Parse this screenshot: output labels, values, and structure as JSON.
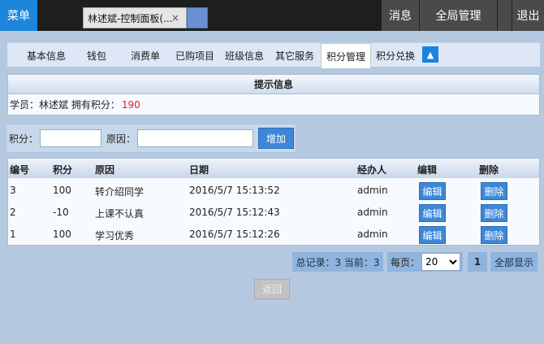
{
  "topbar": {
    "menu": "菜单",
    "doc_tab": "林述斌-控制面板(...",
    "doc_tab_close": "×",
    "messages": "消息",
    "global_admin": "全局管理",
    "logout": "退出"
  },
  "tabs": [
    {
      "label": "基本信息"
    },
    {
      "label": "钱包"
    },
    {
      "label": "消费单"
    },
    {
      "label": "已购项目"
    },
    {
      "label": "班级信息"
    },
    {
      "label": "其它服务"
    },
    {
      "label": "积分管理"
    },
    {
      "label": "积分兑换"
    }
  ],
  "active_tab": "积分管理",
  "tab_up_icon": "▲",
  "info": {
    "title": "提示信息",
    "student_label": "学员：林述斌  拥有积分：",
    "points": "190"
  },
  "form": {
    "score_label": "积分：",
    "reason_label": "原因：",
    "score_value": "",
    "reason_value": "",
    "add_button": "增加"
  },
  "table": {
    "headers": [
      "编号",
      "积分",
      "原因",
      "日期",
      "经办人",
      "编辑",
      "删除"
    ],
    "rows": [
      {
        "id": "3",
        "score": "100",
        "reason": "转介绍同学",
        "date": "2016/5/7 15:13:52",
        "operator": "admin",
        "edit": "编辑",
        "delete": "删除"
      },
      {
        "id": "2",
        "score": "-10",
        "reason": "上课不认真",
        "date": "2016/5/7 15:12:43",
        "operator": "admin",
        "edit": "编辑",
        "delete": "删除"
      },
      {
        "id": "1",
        "score": "100",
        "reason": "学习优秀",
        "date": "2016/5/7 15:12:26",
        "operator": "admin",
        "edit": "编辑",
        "delete": "删除"
      }
    ]
  },
  "pager": {
    "summary": "总记录：3 当前：3",
    "per_page_label": "每页：",
    "per_page_value": "20",
    "current_page": "1",
    "show_all": "全部显示"
  },
  "back_button": "返回",
  "colors": {
    "accent": "#1d86dc",
    "button": "#3e87d6",
    "points": "#e0201f",
    "background": "#b4c8e0"
  }
}
